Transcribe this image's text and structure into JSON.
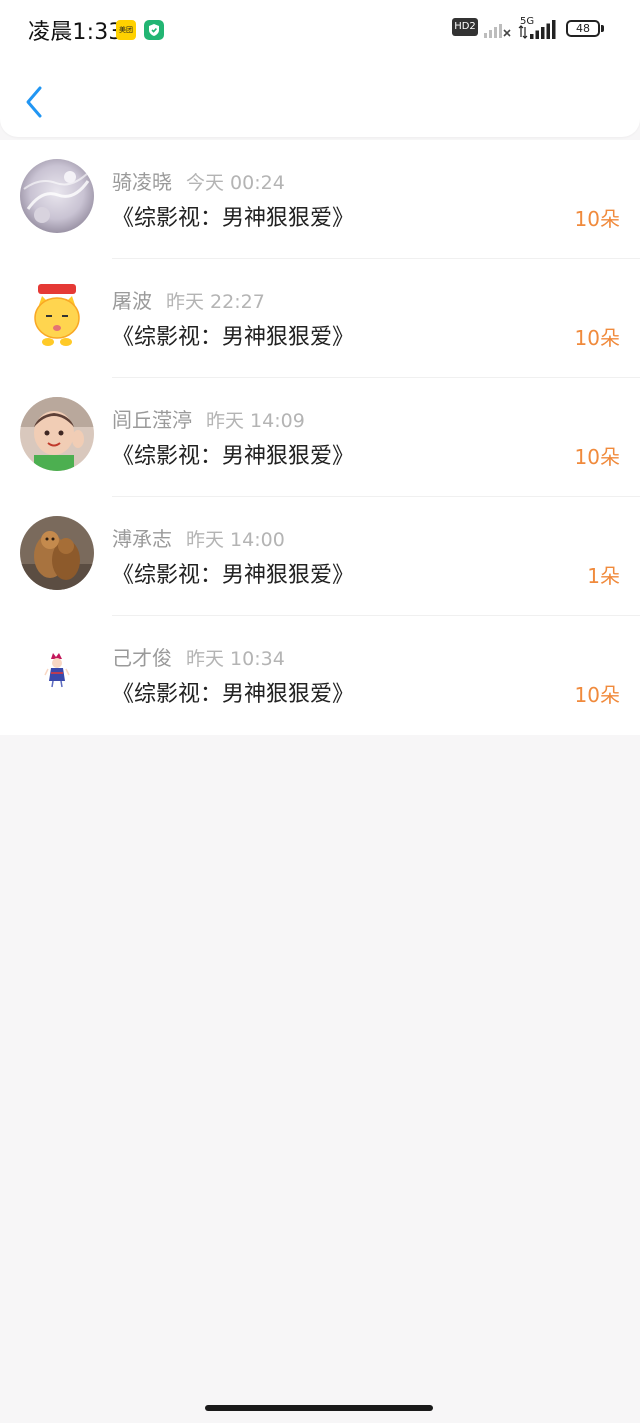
{
  "status_bar": {
    "time": "凌晨1:33",
    "app_badge": "美团",
    "hd_label": "HD2",
    "network_label": "5G",
    "battery_level": "48"
  },
  "colors": {
    "accent_back": "#2196f3",
    "amount": "#f08a3c",
    "name": "#9a9a9a",
    "time": "#b4b4b4"
  },
  "records": [
    {
      "name": "骑凌晓",
      "time": "今天 00:24",
      "title": "《综影视：男神狠狠爱》",
      "amount": "10朵"
    },
    {
      "name": "屠波",
      "time": "昨天 22:27",
      "title": "《综影视：男神狠狠爱》",
      "amount": "10朵"
    },
    {
      "name": "闾丘滢渟",
      "time": "昨天 14:09",
      "title": "《综影视：男神狠狠爱》",
      "amount": "10朵"
    },
    {
      "name": "溥承志",
      "time": "昨天 14:00",
      "title": "《综影视：男神狠狠爱》",
      "amount": "1朵"
    },
    {
      "name": "己才俊",
      "time": "昨天 10:34",
      "title": "《综影视：男神狠狠爱》",
      "amount": "10朵"
    }
  ]
}
